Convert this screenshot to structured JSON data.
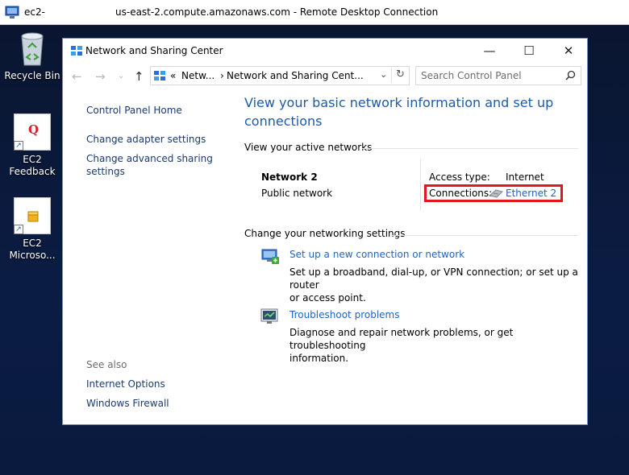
{
  "rdp": {
    "host": "ec2-",
    "title": "us-east-2.compute.amazonaws.com - Remote Desktop Connection"
  },
  "desktop": {
    "icons": [
      {
        "label_1": "Recycle Bin",
        "label_2": ""
      },
      {
        "label_1": "EC2",
        "label_2": "Feedback"
      },
      {
        "label_1": "EC2",
        "label_2": "Microso..."
      }
    ],
    "feedback_glyph": "Q"
  },
  "window": {
    "title": "Network and Sharing Center",
    "controls": {
      "minimize": "—",
      "maximize": "☐",
      "close": "✕"
    },
    "address": {
      "prefix": "«",
      "crumb_1": "Netw...",
      "separator": "›",
      "crumb_2": "Network and Sharing Cent..."
    },
    "search": {
      "placeholder": "Search Control Panel"
    }
  },
  "left_pane": {
    "links": [
      "Control Panel Home",
      "Change adapter settings",
      "Change advanced sharing",
      "settings"
    ],
    "see_also_label": "See also",
    "see_also": [
      "Internet Options",
      "Windows Firewall"
    ]
  },
  "main": {
    "heading_1": "View your basic network information and set up",
    "heading_2": "connections",
    "active_label": "View your active networks",
    "network": {
      "name": "Network  2",
      "type": "Public network",
      "access_label": "Access type:",
      "access_value": "Internet",
      "connections_label": "Connections:",
      "connections_value": "Ethernet 2"
    },
    "settings_label": "Change your networking settings",
    "tasks": [
      {
        "link": "Set up a new connection or network",
        "desc_1": "Set up a broadband, dial-up, or VPN connection; or set up a router",
        "desc_2": "or access point."
      },
      {
        "link": "Troubleshoot problems",
        "desc_1": "Diagnose and repair network problems, or get troubleshooting",
        "desc_2": "information."
      }
    ]
  },
  "colors": {
    "link": "#1f63c2",
    "heading": "#1e5aa8",
    "highlight": "#e0181e",
    "desktop": "#0b1c44"
  },
  "icons": {
    "rdp": "remote-desktop-icon",
    "window": "control-panel-icon",
    "search": "magnifier-icon",
    "ethernet": "ethernet-adapter-icon",
    "setup": "network-setup-icon",
    "troubleshoot": "troubleshoot-icon"
  }
}
